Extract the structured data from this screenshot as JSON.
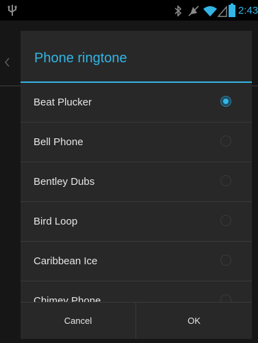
{
  "status_bar": {
    "time": "2:43",
    "icons": [
      "usb-icon",
      "bluetooth-icon",
      "mute-icon",
      "wifi-icon",
      "signal-icon",
      "battery-icon"
    ],
    "accent_color": "#33b5e5"
  },
  "dialog": {
    "title": "Phone ringtone",
    "options": [
      {
        "label": "Beat Plucker",
        "selected": true
      },
      {
        "label": "Bell Phone",
        "selected": false
      },
      {
        "label": "Bentley Dubs",
        "selected": false
      },
      {
        "label": "Bird Loop",
        "selected": false
      },
      {
        "label": "Caribbean Ice",
        "selected": false
      },
      {
        "label": "Chimey Phone",
        "selected": false
      }
    ],
    "cancel_label": "Cancel",
    "ok_label": "OK"
  },
  "colors": {
    "accent": "#33b5e5",
    "dialog_background": "#282828",
    "text": "#e6e6e6"
  }
}
